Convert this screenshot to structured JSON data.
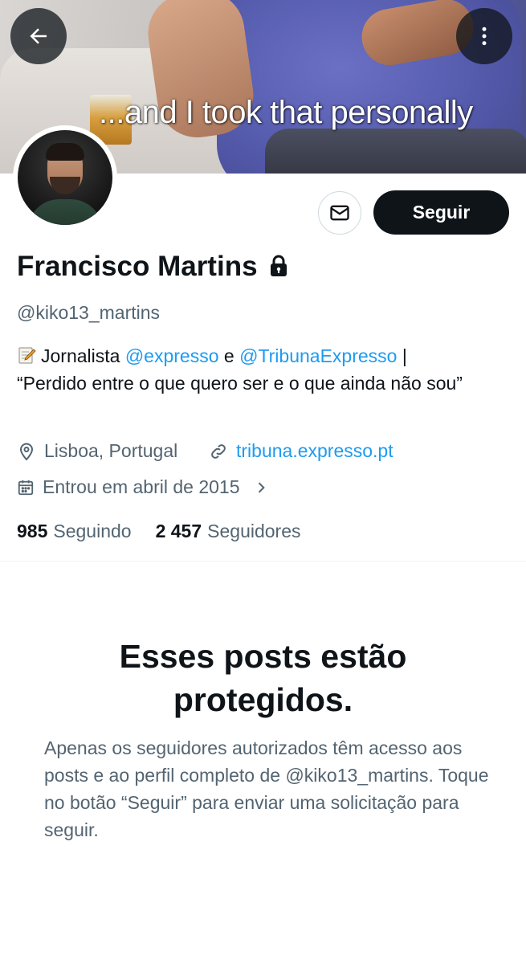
{
  "banner": {
    "meme_text": "...and I took that personally"
  },
  "profile": {
    "display_name": "Francisco Martins",
    "handle": "@kiko13_martins",
    "bio": {
      "prefix": "Jornalista",
      "mention1": "@expresso",
      "connector": "e",
      "mention2": "@TribunaExpresso",
      "pipe": "|",
      "quote": "“Perdido entre o que quero ser e o que ainda não sou”"
    },
    "location": "Lisboa, Portugal",
    "website": "tribuna.expresso.pt",
    "joined": "Entrou em abril de 2015",
    "following_count": "985",
    "following_label": "Seguindo",
    "followers_count": "2 457",
    "followers_label": "Seguidores"
  },
  "actions": {
    "follow_label": "Seguir"
  },
  "protected": {
    "title": "Esses posts estão protegidos.",
    "description": "Apenas os seguidores autorizados têm acesso aos posts e ao perfil completo de @kiko13_martins. Toque no botão “Seguir” para enviar uma solicitação para seguir."
  },
  "icons": {
    "back": "arrow-left-icon",
    "more": "more-vertical-icon",
    "message": "envelope-icon",
    "lock": "lock-icon",
    "location": "map-pin-icon",
    "link": "link-icon",
    "calendar": "calendar-icon",
    "chevron": "chevron-right-icon",
    "memo": "memo-emoji"
  },
  "colors": {
    "accent": "#1d9bf0",
    "primary_text": "#0f1419",
    "secondary_text": "#536471",
    "button_dark": "#0f1419"
  }
}
